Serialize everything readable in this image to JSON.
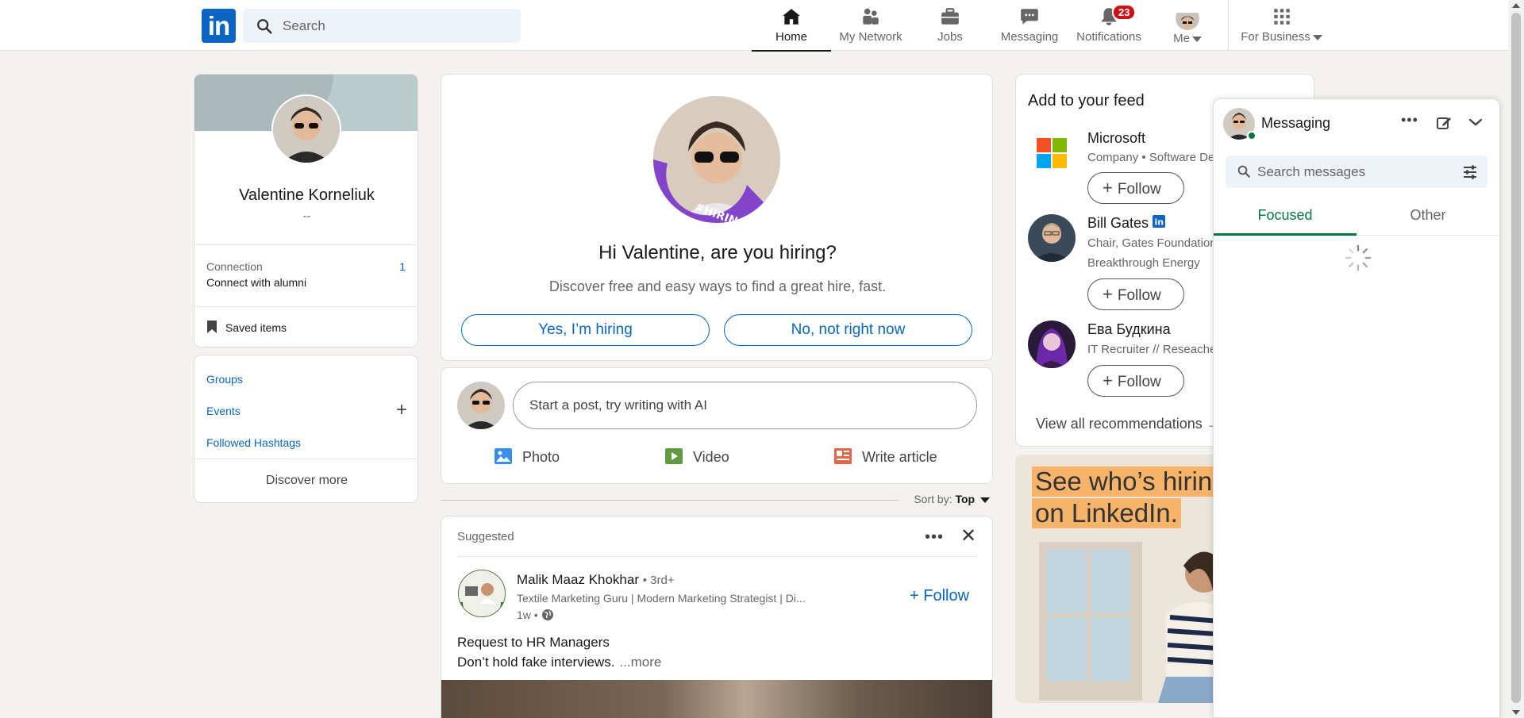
{
  "nav": {
    "search_placeholder": "Search",
    "items": [
      {
        "label": "Home"
      },
      {
        "label": "My Network"
      },
      {
        "label": "Jobs"
      },
      {
        "label": "Messaging"
      },
      {
        "label": "Notifications",
        "badge": "23"
      },
      {
        "label": "Me"
      },
      {
        "label": "For Business"
      }
    ]
  },
  "profile": {
    "name": "Valentine Korneliuk",
    "headline": "--",
    "connection_label": "Connection",
    "connection_count": "1",
    "connection_sub": "Connect with alumni",
    "saved_items": "Saved items"
  },
  "groups": {
    "links": [
      "Groups",
      "Events",
      "Followed Hashtags"
    ],
    "discover_more": "Discover more"
  },
  "hiring": {
    "badge_text": "#HIRING",
    "title": "Hi Valentine, are you hiring?",
    "subtitle": "Discover free and easy ways to find a great hire, fast.",
    "yes_button": "Yes, I’m hiring",
    "no_button": "No, not right now"
  },
  "postbox": {
    "placeholder": "Start a post, try writing with AI",
    "actions": [
      "Photo",
      "Video",
      "Write article"
    ]
  },
  "sort": {
    "label": "Sort by:",
    "value": "Top"
  },
  "post": {
    "suggested": "Suggested",
    "author": "Malik Maaz Khokhar",
    "degree": "• 3rd+",
    "description": "Textile Marketing Guru | Modern Marketing Strategist | Di...",
    "time": "1w •",
    "follow": "+ Follow",
    "line1": "Request to HR Managers",
    "line2": "Don’t hold fake interviews.",
    "more": "...more"
  },
  "feed": {
    "title": "Add to your feed",
    "items": [
      {
        "name": "Microsoft",
        "desc": "Company • Software Dev",
        "follow": "Follow"
      },
      {
        "name": "Bill Gates",
        "desc": "Chair, Gates Foundation",
        "desc2": "Breakthrough Energy",
        "follow": "Follow"
      },
      {
        "name": "Ева Будкина",
        "desc": "IT Recruiter // Reseacher",
        "follow": "Follow"
      }
    ],
    "view_all": "View all recommendations →"
  },
  "ad": {
    "line1": "See who’s hiring",
    "line2": "on LinkedIn."
  },
  "messaging": {
    "title": "Messaging",
    "search_placeholder": "Search messages",
    "tabs": [
      "Focused",
      "Other"
    ]
  },
  "colors": {
    "brand": "#0a66c2",
    "green": "#057642",
    "badge": "#cc1016"
  }
}
